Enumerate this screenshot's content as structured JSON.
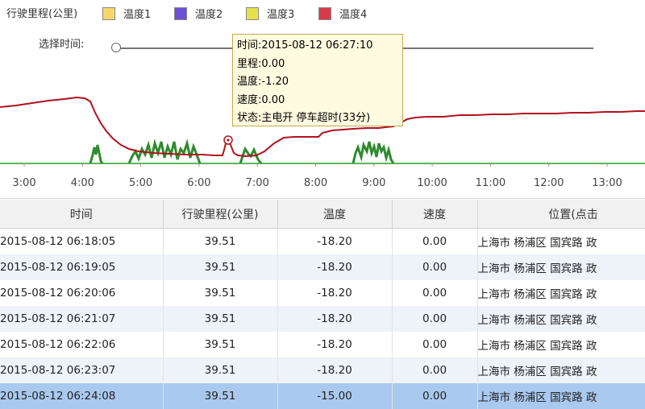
{
  "legend": {
    "items": [
      {
        "label": "行驶里程(公里)",
        "color": ""
      },
      {
        "label": "温度1",
        "color": "#f7d76a"
      },
      {
        "label": "温度2",
        "color": "#6a4fd8"
      },
      {
        "label": "温度3",
        "color": "#e6e04a"
      },
      {
        "label": "温度4",
        "color": "#d93a4a"
      }
    ]
  },
  "slider": {
    "label": "选择时间:"
  },
  "chart": {
    "x_ticks": [
      "3:00",
      "4:00",
      "5:00",
      "6:00",
      "7:00",
      "8:00",
      "9:00",
      "10:00",
      "11:00",
      "12:00",
      "13:00"
    ],
    "temperature_color": "#b0121f",
    "speed_color": "#2e8b2e",
    "baseline_color": "#2c9c2c"
  },
  "tooltip": {
    "time": "时间:2015-08-12 06:27:10",
    "mileage": "里程:0.00",
    "temperature": "温度:-1.20",
    "speed": "速度:0.00",
    "status": "状态:主电开  停车超时(33分)"
  },
  "table": {
    "columns": [
      "时间",
      "行驶里程(公里)",
      "温度",
      "速度",
      "位置(点击"
    ],
    "rows": [
      {
        "time": "2015-08-12 06:18:05",
        "mileage": "39.51",
        "temp": "-18.20",
        "speed": "0.00",
        "location": "上海市 杨浦区 国宾路 政"
      },
      {
        "time": "2015-08-12 06:19:05",
        "mileage": "39.51",
        "temp": "-18.20",
        "speed": "0.00",
        "location": "上海市 杨浦区 国宾路 政"
      },
      {
        "time": "2015-08-12 06:20:06",
        "mileage": "39.51",
        "temp": "-18.20",
        "speed": "0.00",
        "location": "上海市 杨浦区 国宾路 政"
      },
      {
        "time": "2015-08-12 06:21:07",
        "mileage": "39.51",
        "temp": "-18.20",
        "speed": "0.00",
        "location": "上海市 杨浦区 国宾路 政"
      },
      {
        "time": "2015-08-12 06:22:06",
        "mileage": "39.51",
        "temp": "-18.20",
        "speed": "0.00",
        "location": "上海市 杨浦区 国宾路 政"
      },
      {
        "time": "2015-08-12 06:23:07",
        "mileage": "39.51",
        "temp": "-18.20",
        "speed": "0.00",
        "location": "上海市 杨浦区 国宾路 政"
      },
      {
        "time": "2015-08-12 06:24:08",
        "mileage": "39.51",
        "temp": "-15.00",
        "speed": "0.00",
        "location": "上海市 杨浦区 国宾路 政",
        "selected": true
      }
    ]
  }
}
